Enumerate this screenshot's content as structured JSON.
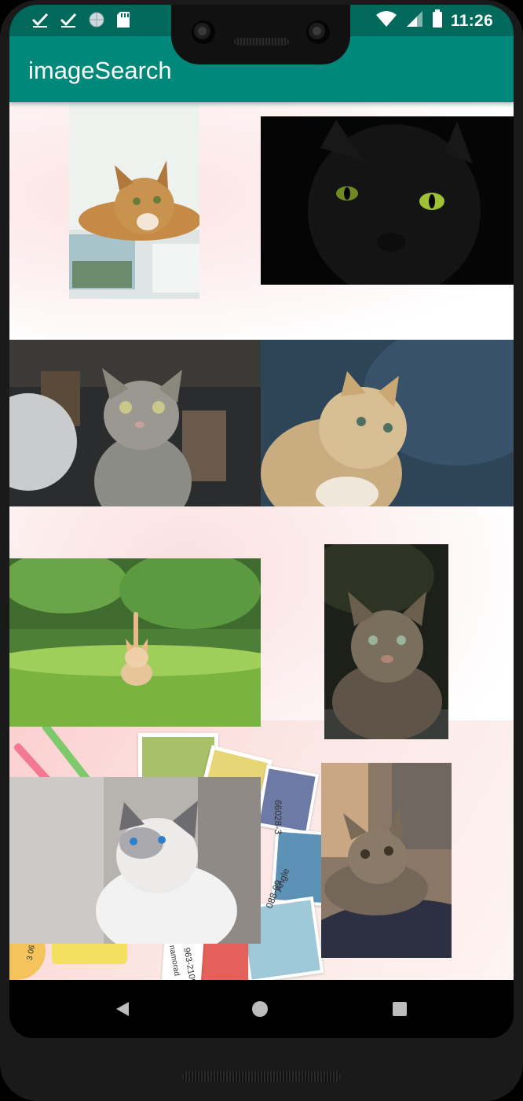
{
  "status_bar": {
    "time": "11:26",
    "left_icons": [
      "check-icon",
      "check-icon",
      "globe-icon",
      "sd-card-icon"
    ],
    "right_icons": [
      "wifi-icon",
      "signal-icon",
      "battery-icon"
    ]
  },
  "app_bar": {
    "title": "imageSearch"
  },
  "grid": {
    "images": [
      {
        "name": "cat-on-postcards",
        "position": "row 1 left"
      },
      {
        "name": "black-cat",
        "position": "row 1 right"
      },
      {
        "name": "tabby-looking-up",
        "position": "row 2 left"
      },
      {
        "name": "fluffy-cream-cat",
        "position": "row 2 right"
      },
      {
        "name": "kitten-in-grass",
        "position": "row 3 left"
      },
      {
        "name": "tabby-portrait",
        "position": "row 3 right"
      },
      {
        "name": "white-blue-eyed-cat",
        "position": "row 4 left"
      },
      {
        "name": "tabby-on-blanket",
        "position": "row 4 right"
      }
    ],
    "background_text": [
      "66028-3",
      "088-09",
      "Angle",
      "963-2109",
      "namorad",
      "3 06"
    ]
  },
  "nav_bar": {
    "buttons": [
      "back-icon",
      "home-icon",
      "recents-icon"
    ]
  },
  "colors": {
    "status_bar": "#00695c",
    "app_bar": "#00897b",
    "nav_bar": "#000000"
  }
}
